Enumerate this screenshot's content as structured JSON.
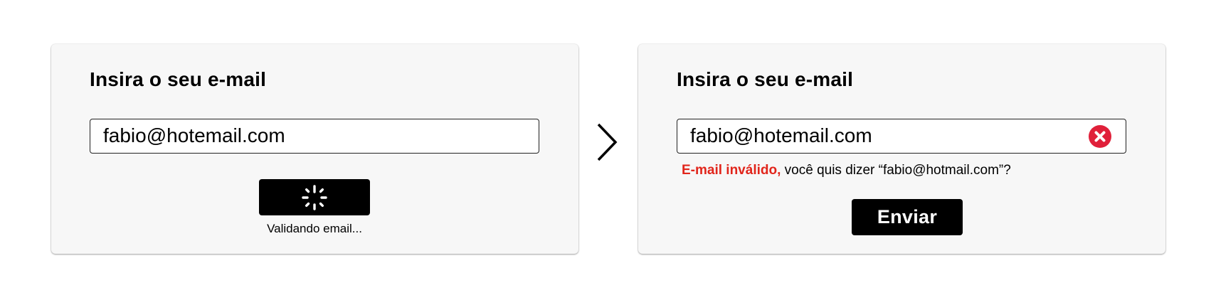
{
  "left_panel": {
    "title": "Insira o seu e-mail",
    "email_value": "fabio@hotemail.com",
    "loading_icon": "spinner-icon",
    "status_text": "Validando email..."
  },
  "transition_icon": "chevron-right-icon",
  "right_panel": {
    "title": "Insira o seu e-mail",
    "email_value": "fabio@hotemail.com",
    "error_icon": "error-x-circle-icon",
    "error_label": "E-mail inválido,",
    "error_suggestion": " você quis dizer “fabio@hotmail.com”?",
    "submit_label": "Enviar"
  },
  "colors": {
    "panel_background": "#f7f7f7",
    "error_red": "#e1251b",
    "error_icon_red": "#e0203a",
    "button_background": "#000000",
    "button_text": "#ffffff"
  }
}
